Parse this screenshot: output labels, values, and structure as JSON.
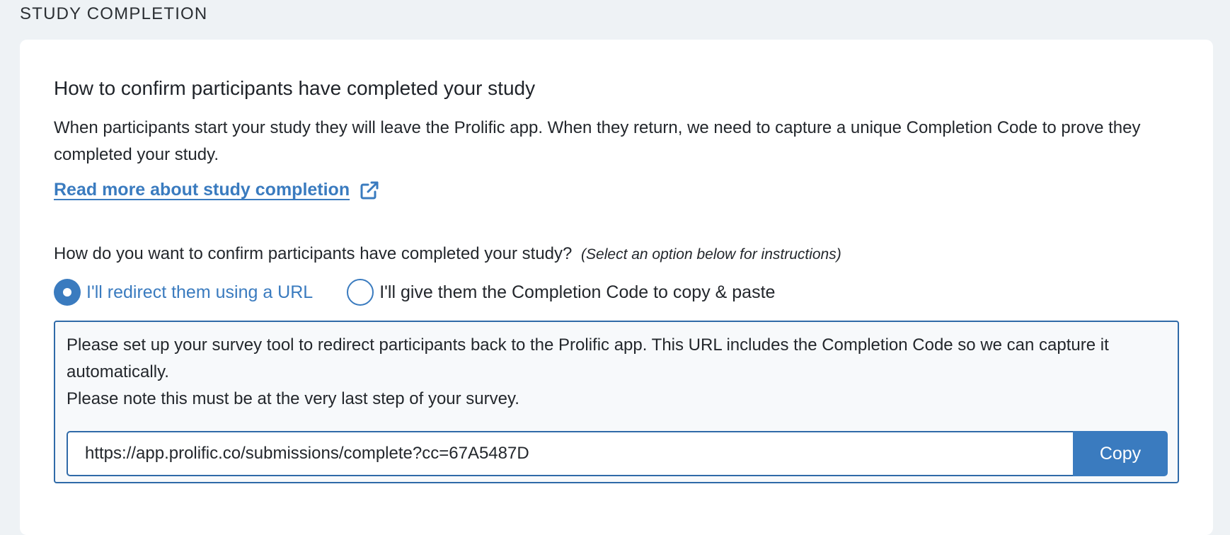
{
  "section": {
    "label": "STUDY COMPLETION"
  },
  "card": {
    "title": "How to confirm participants have completed your study",
    "intro": "When participants start your study they will leave the Prolific app. When they return, we need to capture a unique Completion Code to prove they completed your study.",
    "read_more_label": "Read more about study completion",
    "read_more_icon": "external-link-icon",
    "question": "How do you want to confirm participants have completed your study?",
    "question_hint": "(Select an option below for instructions)",
    "options": [
      {
        "label": "I'll redirect them using a URL",
        "selected": true
      },
      {
        "label": "I'll give them the Completion Code to copy & paste",
        "selected": false
      }
    ],
    "instructions": {
      "line1": "Please set up your survey tool to redirect participants back to the Prolific app. This URL includes the Completion Code so we can capture it automatically.",
      "line2": "Please note this must be at the very last step of your survey.",
      "url_value": "https://app.prolific.co/submissions/complete?cc=67A5487D",
      "copy_label": "Copy"
    }
  },
  "colors": {
    "accent": "#3a7bbf",
    "border": "#2f6aa8",
    "page_background": "#eef2f5"
  }
}
